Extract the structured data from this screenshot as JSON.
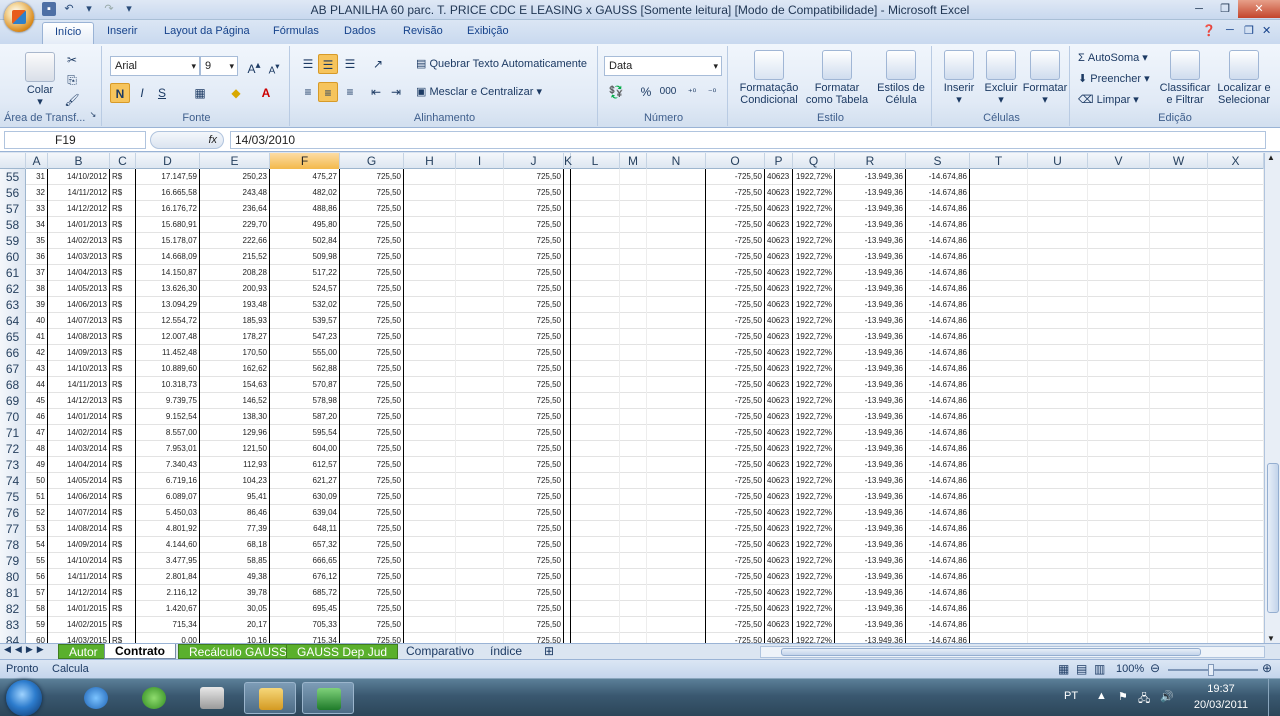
{
  "title_bar": {
    "title": "AB PLANILHA  60 parc. T. PRICE CDC E LEASING x GAUSS  [Somente leitura]  [Modo de Compatibilidade] - Microsoft Excel"
  },
  "tabs": [
    "Início",
    "Inserir",
    "Layout da Página",
    "Fórmulas",
    "Dados",
    "Revisão",
    "Exibição"
  ],
  "ribbon": {
    "clipboard": {
      "paste": "Colar",
      "label": "Área de Transf..."
    },
    "font": {
      "name": "Arial",
      "size": "9",
      "label": "Fonte",
      "bold": "N",
      "italic": "I",
      "underline": "S"
    },
    "alignment": {
      "wrap": "Quebrar Texto Automaticamente",
      "merge": "Mesclar e Centralizar",
      "label": "Alinhamento"
    },
    "number": {
      "format": "Data",
      "percent": "%",
      "thousands": "000",
      "label": "Número"
    },
    "styles": {
      "conditional": "Formatação Condicional",
      "table": "Formatar como Tabela",
      "cell": "Estilos de Célula",
      "label": "Estilo"
    },
    "cells": {
      "insert": "Inserir",
      "delete": "Excluir",
      "format": "Formatar",
      "label": "Células"
    },
    "editing": {
      "autosum": "AutoSoma",
      "fill": "Preencher",
      "clear": "Limpar",
      "sort": "Classificar e Filtrar",
      "find": "Localizar e Selecionar",
      "label": "Edição"
    }
  },
  "formula_bar": {
    "name_box": "F19",
    "fx": "fx",
    "content": "14/03/2010"
  },
  "columns": [
    "A",
    "B",
    "C",
    "D",
    "E",
    "F",
    "G",
    "H",
    "I",
    "J",
    "K",
    "L",
    "M",
    "N",
    "O",
    "P",
    "Q",
    "R",
    "S",
    "T",
    "U",
    "V",
    "W",
    "X"
  ],
  "selected_column": "F",
  "rows": [
    {
      "n": "55",
      "a": "31",
      "b": "14/10/2012",
      "c": "R$",
      "d": "17.147,59",
      "e": "250,23",
      "f": "475,27",
      "g": "725,50",
      "j": "725,50",
      "o": "-725,50",
      "p": "40623",
      "q": "1922,72%",
      "r": "-13.949,36",
      "s": "-14.674,86"
    },
    {
      "n": "56",
      "a": "32",
      "b": "14/11/2012",
      "c": "R$",
      "d": "16.665,58",
      "e": "243,48",
      "f": "482,02",
      "g": "725,50",
      "j": "725,50",
      "o": "-725,50",
      "p": "40623",
      "q": "1922,72%",
      "r": "-13.949,36",
      "s": "-14.674,86"
    },
    {
      "n": "57",
      "a": "33",
      "b": "14/12/2012",
      "c": "R$",
      "d": "16.176,72",
      "e": "236,64",
      "f": "488,86",
      "g": "725,50",
      "j": "725,50",
      "o": "-725,50",
      "p": "40623",
      "q": "1922,72%",
      "r": "-13.949,36",
      "s": "-14.674,86"
    },
    {
      "n": "58",
      "a": "34",
      "b": "14/01/2013",
      "c": "R$",
      "d": "15.680,91",
      "e": "229,70",
      "f": "495,80",
      "g": "725,50",
      "j": "725,50",
      "o": "-725,50",
      "p": "40623",
      "q": "1922,72%",
      "r": "-13.949,36",
      "s": "-14.674,86"
    },
    {
      "n": "59",
      "a": "35",
      "b": "14/02/2013",
      "c": "R$",
      "d": "15.178,07",
      "e": "222,66",
      "f": "502,84",
      "g": "725,50",
      "j": "725,50",
      "o": "-725,50",
      "p": "40623",
      "q": "1922,72%",
      "r": "-13.949,36",
      "s": "-14.674,86"
    },
    {
      "n": "60",
      "a": "36",
      "b": "14/03/2013",
      "c": "R$",
      "d": "14.668,09",
      "e": "215,52",
      "f": "509,98",
      "g": "725,50",
      "j": "725,50",
      "o": "-725,50",
      "p": "40623",
      "q": "1922,72%",
      "r": "-13.949,36",
      "s": "-14.674,86"
    },
    {
      "n": "61",
      "a": "37",
      "b": "14/04/2013",
      "c": "R$",
      "d": "14.150,87",
      "e": "208,28",
      "f": "517,22",
      "g": "725,50",
      "j": "725,50",
      "o": "-725,50",
      "p": "40623",
      "q": "1922,72%",
      "r": "-13.949,36",
      "s": "-14.674,86"
    },
    {
      "n": "62",
      "a": "38",
      "b": "14/05/2013",
      "c": "R$",
      "d": "13.626,30",
      "e": "200,93",
      "f": "524,57",
      "g": "725,50",
      "j": "725,50",
      "o": "-725,50",
      "p": "40623",
      "q": "1922,72%",
      "r": "-13.949,36",
      "s": "-14.674,86"
    },
    {
      "n": "63",
      "a": "39",
      "b": "14/06/2013",
      "c": "R$",
      "d": "13.094,29",
      "e": "193,48",
      "f": "532,02",
      "g": "725,50",
      "j": "725,50",
      "o": "-725,50",
      "p": "40623",
      "q": "1922,72%",
      "r": "-13.949,36",
      "s": "-14.674,86"
    },
    {
      "n": "64",
      "a": "40",
      "b": "14/07/2013",
      "c": "R$",
      "d": "12.554,72",
      "e": "185,93",
      "f": "539,57",
      "g": "725,50",
      "j": "725,50",
      "o": "-725,50",
      "p": "40623",
      "q": "1922,72%",
      "r": "-13.949,36",
      "s": "-14.674,86"
    },
    {
      "n": "65",
      "a": "41",
      "b": "14/08/2013",
      "c": "R$",
      "d": "12.007,48",
      "e": "178,27",
      "f": "547,23",
      "g": "725,50",
      "j": "725,50",
      "o": "-725,50",
      "p": "40623",
      "q": "1922,72%",
      "r": "-13.949,36",
      "s": "-14.674,86"
    },
    {
      "n": "66",
      "a": "42",
      "b": "14/09/2013",
      "c": "R$",
      "d": "11.452,48",
      "e": "170,50",
      "f": "555,00",
      "g": "725,50",
      "j": "725,50",
      "o": "-725,50",
      "p": "40623",
      "q": "1922,72%",
      "r": "-13.949,36",
      "s": "-14.674,86"
    },
    {
      "n": "67",
      "a": "43",
      "b": "14/10/2013",
      "c": "R$",
      "d": "10.889,60",
      "e": "162,62",
      "f": "562,88",
      "g": "725,50",
      "j": "725,50",
      "o": "-725,50",
      "p": "40623",
      "q": "1922,72%",
      "r": "-13.949,36",
      "s": "-14.674,86"
    },
    {
      "n": "68",
      "a": "44",
      "b": "14/11/2013",
      "c": "R$",
      "d": "10.318,73",
      "e": "154,63",
      "f": "570,87",
      "g": "725,50",
      "j": "725,50",
      "o": "-725,50",
      "p": "40623",
      "q": "1922,72%",
      "r": "-13.949,36",
      "s": "-14.674,86"
    },
    {
      "n": "69",
      "a": "45",
      "b": "14/12/2013",
      "c": "R$",
      "d": "9.739,75",
      "e": "146,52",
      "f": "578,98",
      "g": "725,50",
      "j": "725,50",
      "o": "-725,50",
      "p": "40623",
      "q": "1922,72%",
      "r": "-13.949,36",
      "s": "-14.674,86"
    },
    {
      "n": "70",
      "a": "46",
      "b": "14/01/2014",
      "c": "R$",
      "d": "9.152,54",
      "e": "138,30",
      "f": "587,20",
      "g": "725,50",
      "j": "725,50",
      "o": "-725,50",
      "p": "40623",
      "q": "1922,72%",
      "r": "-13.949,36",
      "s": "-14.674,86"
    },
    {
      "n": "71",
      "a": "47",
      "b": "14/02/2014",
      "c": "R$",
      "d": "8.557,00",
      "e": "129,96",
      "f": "595,54",
      "g": "725,50",
      "j": "725,50",
      "o": "-725,50",
      "p": "40623",
      "q": "1922,72%",
      "r": "-13.949,36",
      "s": "-14.674,86"
    },
    {
      "n": "72",
      "a": "48",
      "b": "14/03/2014",
      "c": "R$",
      "d": "7.953,01",
      "e": "121,50",
      "f": "604,00",
      "g": "725,50",
      "j": "725,50",
      "o": "-725,50",
      "p": "40623",
      "q": "1922,72%",
      "r": "-13.949,36",
      "s": "-14.674,86"
    },
    {
      "n": "73",
      "a": "49",
      "b": "14/04/2014",
      "c": "R$",
      "d": "7.340,43",
      "e": "112,93",
      "f": "612,57",
      "g": "725,50",
      "j": "725,50",
      "o": "-725,50",
      "p": "40623",
      "q": "1922,72%",
      "r": "-13.949,36",
      "s": "-14.674,86"
    },
    {
      "n": "74",
      "a": "50",
      "b": "14/05/2014",
      "c": "R$",
      "d": "6.719,16",
      "e": "104,23",
      "f": "621,27",
      "g": "725,50",
      "j": "725,50",
      "o": "-725,50",
      "p": "40623",
      "q": "1922,72%",
      "r": "-13.949,36",
      "s": "-14.674,86"
    },
    {
      "n": "75",
      "a": "51",
      "b": "14/06/2014",
      "c": "R$",
      "d": "6.089,07",
      "e": "95,41",
      "f": "630,09",
      "g": "725,50",
      "j": "725,50",
      "o": "-725,50",
      "p": "40623",
      "q": "1922,72%",
      "r": "-13.949,36",
      "s": "-14.674,86"
    },
    {
      "n": "76",
      "a": "52",
      "b": "14/07/2014",
      "c": "R$",
      "d": "5.450,03",
      "e": "86,46",
      "f": "639,04",
      "g": "725,50",
      "j": "725,50",
      "o": "-725,50",
      "p": "40623",
      "q": "1922,72%",
      "r": "-13.949,36",
      "s": "-14.674,86"
    },
    {
      "n": "77",
      "a": "53",
      "b": "14/08/2014",
      "c": "R$",
      "d": "4.801,92",
      "e": "77,39",
      "f": "648,11",
      "g": "725,50",
      "j": "725,50",
      "o": "-725,50",
      "p": "40623",
      "q": "1922,72%",
      "r": "-13.949,36",
      "s": "-14.674,86"
    },
    {
      "n": "78",
      "a": "54",
      "b": "14/09/2014",
      "c": "R$",
      "d": "4.144,60",
      "e": "68,18",
      "f": "657,32",
      "g": "725,50",
      "j": "725,50",
      "o": "-725,50",
      "p": "40623",
      "q": "1922,72%",
      "r": "-13.949,36",
      "s": "-14.674,86"
    },
    {
      "n": "79",
      "a": "55",
      "b": "14/10/2014",
      "c": "R$",
      "d": "3.477,95",
      "e": "58,85",
      "f": "666,65",
      "g": "725,50",
      "j": "725,50",
      "o": "-725,50",
      "p": "40623",
      "q": "1922,72%",
      "r": "-13.949,36",
      "s": "-14.674,86"
    },
    {
      "n": "80",
      "a": "56",
      "b": "14/11/2014",
      "c": "R$",
      "d": "2.801,84",
      "e": "49,38",
      "f": "676,12",
      "g": "725,50",
      "j": "725,50",
      "o": "-725,50",
      "p": "40623",
      "q": "1922,72%",
      "r": "-13.949,36",
      "s": "-14.674,86"
    },
    {
      "n": "81",
      "a": "57",
      "b": "14/12/2014",
      "c": "R$",
      "d": "2.116,12",
      "e": "39,78",
      "f": "685,72",
      "g": "725,50",
      "j": "725,50",
      "o": "-725,50",
      "p": "40623",
      "q": "1922,72%",
      "r": "-13.949,36",
      "s": "-14.674,86"
    },
    {
      "n": "82",
      "a": "58",
      "b": "14/01/2015",
      "c": "R$",
      "d": "1.420,67",
      "e": "30,05",
      "f": "695,45",
      "g": "725,50",
      "j": "725,50",
      "o": "-725,50",
      "p": "40623",
      "q": "1922,72%",
      "r": "-13.949,36",
      "s": "-14.674,86"
    },
    {
      "n": "83",
      "a": "59",
      "b": "14/02/2015",
      "c": "R$",
      "d": "715,34",
      "e": "20,17",
      "f": "705,33",
      "g": "725,50",
      "j": "725,50",
      "o": "-725,50",
      "p": "40623",
      "q": "1922,72%",
      "r": "-13.949,36",
      "s": "-14.674,86"
    },
    {
      "n": "84",
      "a": "60",
      "b": "14/03/2015",
      "c": "R$",
      "d": "0,00",
      "e": "10,16",
      "f": "715,34",
      "g": "725,50",
      "j": "725,50",
      "o": "-725,50",
      "p": "40623",
      "q": "1922,72%",
      "r": "-13.949,36",
      "s": "-14.674,86"
    }
  ],
  "sheet_tabs": [
    "Autor",
    "Contrato",
    "Recálculo GAUSS",
    "GAUSS Dep Jud",
    "Comparativo",
    "índice"
  ],
  "active_sheet": "Contrato",
  "status": {
    "ready": "Pronto",
    "calc": "Calcula",
    "zoom": "100%"
  },
  "tray": {
    "lang": "PT",
    "time": "19:37",
    "date": "20/03/2011"
  },
  "colors": {
    "selected_col": "#f3b94b",
    "green_tab": "#5ab02d"
  }
}
